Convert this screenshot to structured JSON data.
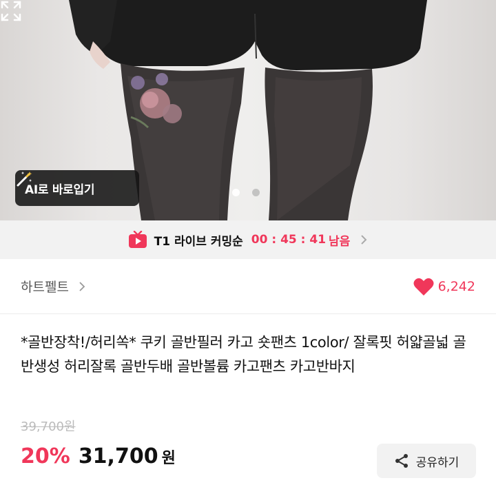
{
  "hero": {
    "ai_button_label": "AI로 바로입기",
    "carousel": {
      "total": 2,
      "active": 1
    }
  },
  "live": {
    "title": "T1 라이브 커밍순",
    "timer": "00 : 45 : 41",
    "remaining_label": "남음"
  },
  "seller": {
    "name": "하트펠트",
    "like_count": "6,242"
  },
  "product": {
    "title": "*골반장착!/허리쏙* 쿠키 골반필러 카고 숏팬츠 1color/ 잘록핏 허얇골넓 골반생성 허리잘록 골반두배 골반볼륨 카고팬츠 카고반바지",
    "original_price": "39,700원",
    "discount": "20%",
    "price": "31,700",
    "currency": "원"
  },
  "share": {
    "label": "공유하기"
  },
  "colors": {
    "accent": "#f0375a",
    "live_bar_bg": "#f2f2f2"
  }
}
